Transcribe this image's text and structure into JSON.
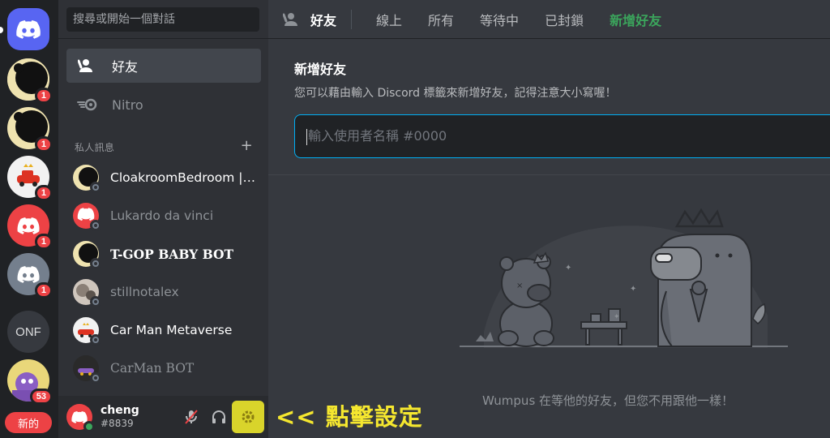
{
  "servers": [
    {
      "name": "home",
      "icon": "discord-logo-icon"
    },
    {
      "name": "server-1",
      "badge": "1",
      "icon": "eclipse-avatar-icon"
    },
    {
      "name": "server-2",
      "badge": "1",
      "icon": "eclipse-avatar-icon"
    },
    {
      "name": "server-3",
      "badge": "1",
      "icon": "car-avatar-icon"
    },
    {
      "name": "server-4",
      "badge": "1",
      "icon": "discord-red-avatar-icon"
    },
    {
      "name": "server-5",
      "badge": "1",
      "icon": "discord-grey-avatar-icon"
    },
    {
      "name": "server-onf",
      "label": "ONF"
    },
    {
      "name": "server-7",
      "badge": "53",
      "icon": "cartoon-avatar-icon"
    }
  ],
  "new_pill": "新的",
  "search_placeholder": "搜尋或開始一個對話",
  "nav": {
    "friends": "好友",
    "nitro": "Nitro"
  },
  "dm_header": "私人訊息",
  "dms": [
    {
      "name": "CloakroomBedroom | ..."
    },
    {
      "name": "Lukardo da vinci"
    },
    {
      "name": "T-GOP BABY BOT"
    },
    {
      "name": "stillnotalex"
    },
    {
      "name": "Car Man Metaverse"
    },
    {
      "name": "CarMan BOT"
    }
  ],
  "user": {
    "name": "cheng",
    "tag": "#8839"
  },
  "hint": "<< 點擊設定",
  "header": {
    "title": "好友",
    "tabs": [
      "線上",
      "所有",
      "等待中",
      "已封鎖"
    ],
    "add_tab": "新增好友"
  },
  "add_friend": {
    "title": "新增好友",
    "description": "您可以藉由輸入 Discord 標籤來新增好友，記得注意大小寫喔！",
    "placeholder": "輸入使用者名稱 #0000"
  },
  "empty_state": "Wumpus 在等他的好友，但您不用跟他一樣！",
  "colors": {
    "accent": "#5865f2",
    "add_green": "#3ba55c",
    "badge_red": "#ed4245",
    "highlight_yellow": "#f5e72f"
  }
}
